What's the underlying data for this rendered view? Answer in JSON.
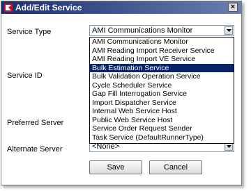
{
  "window": {
    "title": "Add/Edit Service",
    "close_glyph": "×"
  },
  "form": {
    "service_type": {
      "label": "Service Type",
      "value": "AMI Communications Monitor",
      "options": [
        "AMI Communications Monitor",
        "AMI Reading Import Receiver Service",
        "AMI Reading Import VE Service",
        "Bulk Estimation Service",
        "Bulk Validation Operation Service",
        "Cycle Scheduler Service",
        "Gap Fill Interrogation Service",
        "Import Dispatcher Service",
        "Internal Web Service Host",
        "Public Web Service Host",
        "Service Order Request Sender",
        "Task Service (DefaultRunnerType)"
      ],
      "selected_option": "Bulk Estimation Service"
    },
    "service_id": {
      "label": "Service ID"
    },
    "preferred_server": {
      "label": "Preferred Server"
    },
    "alternate_server": {
      "label": "Alternate Server",
      "value": "<None>"
    }
  },
  "buttons": {
    "save": "Save",
    "cancel": "Cancel"
  },
  "colors": {
    "title_bar": "#1b2e6e",
    "selection": "#0a246a",
    "app_icon": "#c8102e"
  }
}
